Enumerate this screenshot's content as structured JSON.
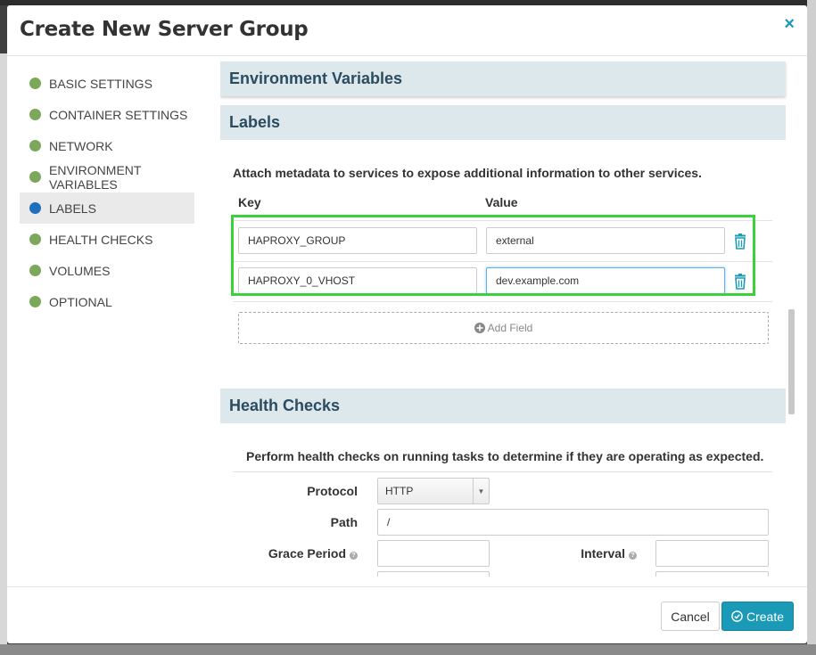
{
  "modal": {
    "title": "Create New Server Group",
    "close_glyph": "×"
  },
  "sidebar": {
    "items": [
      {
        "label": "BASIC SETTINGS",
        "active": false
      },
      {
        "label": "CONTAINER SETTINGS",
        "active": false
      },
      {
        "label": "NETWORK",
        "active": false
      },
      {
        "label": "ENVIRONMENT VARIABLES",
        "active": false
      },
      {
        "label": "LABELS",
        "active": true
      },
      {
        "label": "HEALTH CHECKS",
        "active": false
      },
      {
        "label": "VOLUMES",
        "active": false
      },
      {
        "label": "OPTIONAL",
        "active": false
      }
    ],
    "colors": {
      "complete": "#7ba85a",
      "active": "#1f6fbd"
    }
  },
  "sections": {
    "env_vars": {
      "title": "Environment Variables"
    },
    "labels": {
      "title": "Labels",
      "description": "Attach metadata to services to expose additional information to other services.",
      "key_header": "Key",
      "value_header": "Value",
      "rows": [
        {
          "key": "HAPROXY_GROUP",
          "value": "external"
        },
        {
          "key": "HAPROXY_0_VHOST",
          "value": "dev.example.com"
        }
      ],
      "add_field_label": "Add Field"
    },
    "health_checks": {
      "title": "Health Checks",
      "description": "Perform health checks on running tasks to determine if they are operating as expected.",
      "protocol_label": "Protocol",
      "protocol_value": "HTTP",
      "path_label": "Path",
      "path_value": "/",
      "grace_period_label": "Grace Period",
      "grace_period_value": "",
      "interval_label": "Interval",
      "interval_value": "",
      "help_glyph": "?"
    }
  },
  "footer": {
    "cancel_label": "Cancel",
    "create_label": "Create"
  },
  "colors": {
    "accent": "#1a9ab6",
    "section_bg": "#dde8ec",
    "highlight": "#3ad13a"
  }
}
